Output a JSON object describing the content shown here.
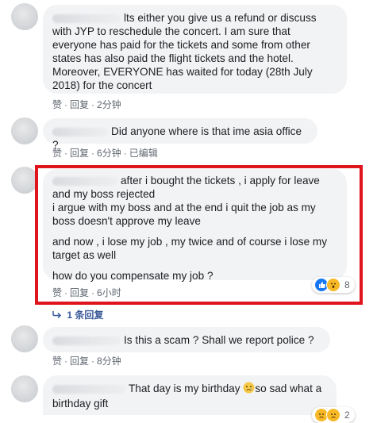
{
  "comments": [
    {
      "text": "lts either you give us a refund or discuss with JYP to reschedule the concert. I am sure that everyone has paid for the tickets and some from other states has also paid the flight tickets and the hotel. Moreover, EVERYONE has waited for today (28th July 2018) for the concert",
      "actions": {
        "like": "赞",
        "reply": "回复",
        "time": "2分钟"
      }
    },
    {
      "text": "Did anyone where is that ime asia office ?",
      "actions": {
        "like": "赞",
        "reply": "回复",
        "time": "6分钟",
        "edited": "已编辑"
      }
    },
    {
      "paragraphs": [
        "after i bought the tickets , i apply for leave and my boss rejected",
        "i argue with my boss and at the end i quit the job as my boss doesn't approve my leave",
        "and now , i lose my job , my twice and of course i lose my target as well",
        "how do you compensate my job ?"
      ],
      "reaction_count": "8",
      "actions": {
        "like": "赞",
        "reply": "回复",
        "time": "6小时"
      },
      "replies_link": "1 条回复"
    },
    {
      "text": "Is this a scam ? Shall we report police ?",
      "actions": {
        "like": "赞",
        "reply": "回复",
        "time": "8分钟"
      }
    },
    {
      "text_before": "That day is my birthday",
      "text_after": "so sad what a birthday gift",
      "reaction_count": "2"
    }
  ],
  "colors": {
    "highlight": "#e0141c",
    "bubble": "#f2f3f5",
    "link": "#385898",
    "meta": "#606770"
  }
}
